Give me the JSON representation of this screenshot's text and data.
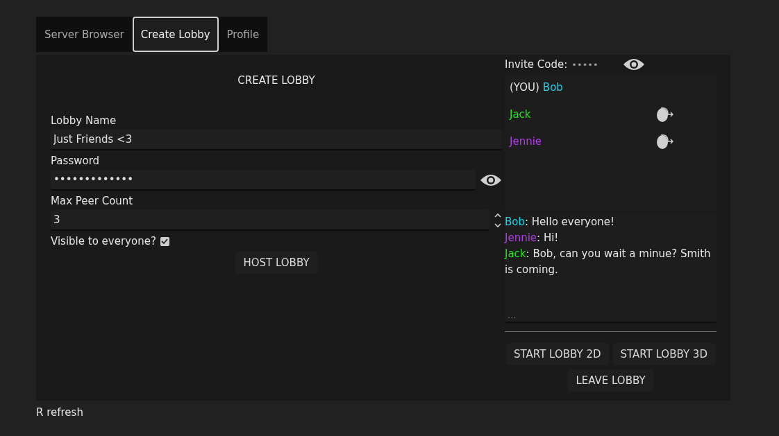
{
  "tabs": [
    {
      "label": "Server Browser",
      "selected": false
    },
    {
      "label": "Create Lobby",
      "selected": true
    },
    {
      "label": "Profile",
      "selected": false
    }
  ],
  "create_form": {
    "title": "CREATE LOBBY",
    "fields": [
      {
        "kind": "text",
        "label": "Lobby Name",
        "value": "Just Friends <3"
      },
      {
        "kind": "password",
        "label": "Password",
        "value": "•••••••••••••"
      },
      {
        "kind": "number",
        "label": "Max Peer Count",
        "value": "3"
      }
    ],
    "visible": {
      "label": "Visible to everyone?",
      "checked": true
    },
    "button": "HOST LOBBY"
  },
  "lobby": {
    "invite_label": "Invite Code:",
    "invite_code": "•••••",
    "players": [
      {
        "prefix": "(YOU)",
        "name": "Bob",
        "color": "#22d3e6",
        "kickable": false
      },
      {
        "name": "Jack",
        "color": "#22e61a",
        "kickable": true
      },
      {
        "name": "Jennie",
        "color": "#b03ee8",
        "kickable": true
      }
    ],
    "messages": [
      {
        "author": "Bob",
        "color": "#22d3e6",
        "text": ": Hello everyone!"
      },
      {
        "author": "Jennie",
        "color": "#b03ee8",
        "text": ": Hi!"
      },
      {
        "author": "Jack",
        "color": "#22e61a",
        "text": ": Bob, can you wait a minue? Smith is coming."
      }
    ],
    "chat_placeholder": "...",
    "buttons": [
      "START LOBBY 2D",
      "START LOBBY 3D",
      "LEAVE LOBBY"
    ]
  },
  "footer": "R refresh"
}
